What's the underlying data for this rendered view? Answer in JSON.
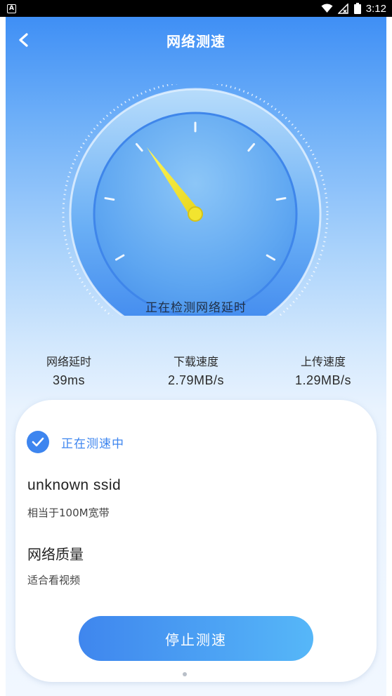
{
  "status_bar": {
    "app_badge": "A",
    "time": "3:12"
  },
  "header": {
    "title": "网络测速"
  },
  "gauge": {
    "status_text": "正在检测网络延时",
    "needle_level": 0.35
  },
  "stats": {
    "latency": {
      "label": "网络延时",
      "value": "39ms"
    },
    "download": {
      "label": "下载速度",
      "value": "2.79MB/s"
    },
    "upload": {
      "label": "上传速度",
      "value": "1.29MB/s"
    }
  },
  "card": {
    "testing_text": "正在测速中",
    "ssid": "unknown ssid",
    "bandwidth": "相当于100M宽带",
    "quality_title": "网络质量",
    "quality_desc": "适合看视频",
    "stop_button": "停止测速"
  },
  "colors": {
    "accent": "#3d85ef",
    "button_start": "#3f86ee",
    "button_end": "#56b7f8",
    "needle": "#f4ea3a"
  }
}
